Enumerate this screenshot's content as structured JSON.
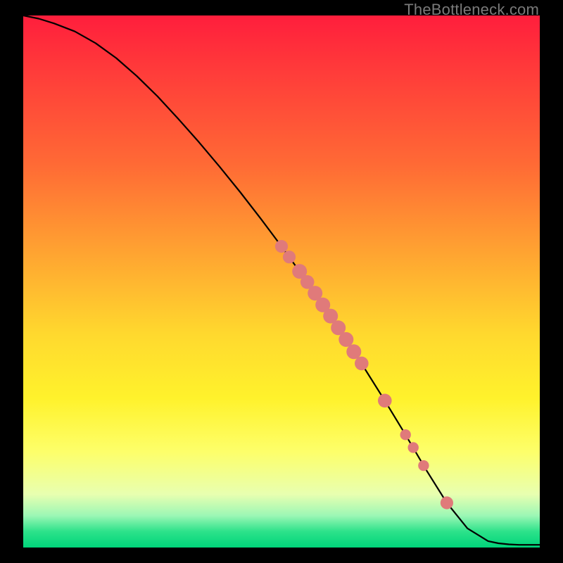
{
  "watermark": "TheBottleneck.com",
  "colors": {
    "page_bg": "#000000",
    "curve": "#000000",
    "marker": "#e07a7a",
    "gradient_stops": [
      "#ff1e3c",
      "#ff3a3a",
      "#ff6a35",
      "#ffa531",
      "#ffd92e",
      "#fff22c",
      "#fdff6a",
      "#e8ffb0",
      "#9cf7b5",
      "#2ce28a",
      "#00d47a"
    ]
  },
  "chart_data": {
    "type": "line",
    "title": "",
    "xlabel": "",
    "ylabel": "",
    "xlim": [
      0,
      100
    ],
    "ylim": [
      0,
      100
    ],
    "series": [
      {
        "name": "curve",
        "x": [
          0,
          3,
          6,
          10,
          14,
          18,
          22,
          26,
          30,
          34,
          38,
          42,
          46,
          50,
          54,
          58,
          62,
          66,
          70,
          74,
          78,
          82,
          86,
          90,
          92,
          94,
          96,
          98,
          100
        ],
        "y": [
          100,
          99.4,
          98.5,
          97.0,
          94.8,
          92.0,
          88.6,
          84.8,
          80.6,
          76.2,
          71.6,
          66.8,
          61.8,
          56.6,
          51.2,
          45.6,
          39.8,
          33.8,
          27.6,
          21.2,
          14.6,
          8.4,
          3.6,
          1.2,
          0.8,
          0.6,
          0.5,
          0.5,
          0.5
        ]
      }
    ],
    "markers": {
      "name": "highlighted-points",
      "points": [
        {
          "x": 50.0,
          "y": 56.6,
          "r": 1.3
        },
        {
          "x": 51.5,
          "y": 54.6,
          "r": 1.3
        },
        {
          "x": 53.5,
          "y": 51.9,
          "r": 1.5
        },
        {
          "x": 55.0,
          "y": 49.9,
          "r": 1.4
        },
        {
          "x": 56.5,
          "y": 47.8,
          "r": 1.5
        },
        {
          "x": 58.0,
          "y": 45.6,
          "r": 1.5
        },
        {
          "x": 59.5,
          "y": 43.5,
          "r": 1.5
        },
        {
          "x": 61.0,
          "y": 41.3,
          "r": 1.5
        },
        {
          "x": 62.5,
          "y": 39.1,
          "r": 1.5
        },
        {
          "x": 64.0,
          "y": 36.8,
          "r": 1.5
        },
        {
          "x": 65.5,
          "y": 34.6,
          "r": 1.4
        },
        {
          "x": 70.0,
          "y": 27.6,
          "r": 1.4
        },
        {
          "x": 74.0,
          "y": 21.2,
          "r": 1.1
        },
        {
          "x": 75.5,
          "y": 18.8,
          "r": 1.1
        },
        {
          "x": 77.5,
          "y": 15.4,
          "r": 1.1
        },
        {
          "x": 82.0,
          "y": 8.4,
          "r": 1.3
        }
      ]
    }
  }
}
